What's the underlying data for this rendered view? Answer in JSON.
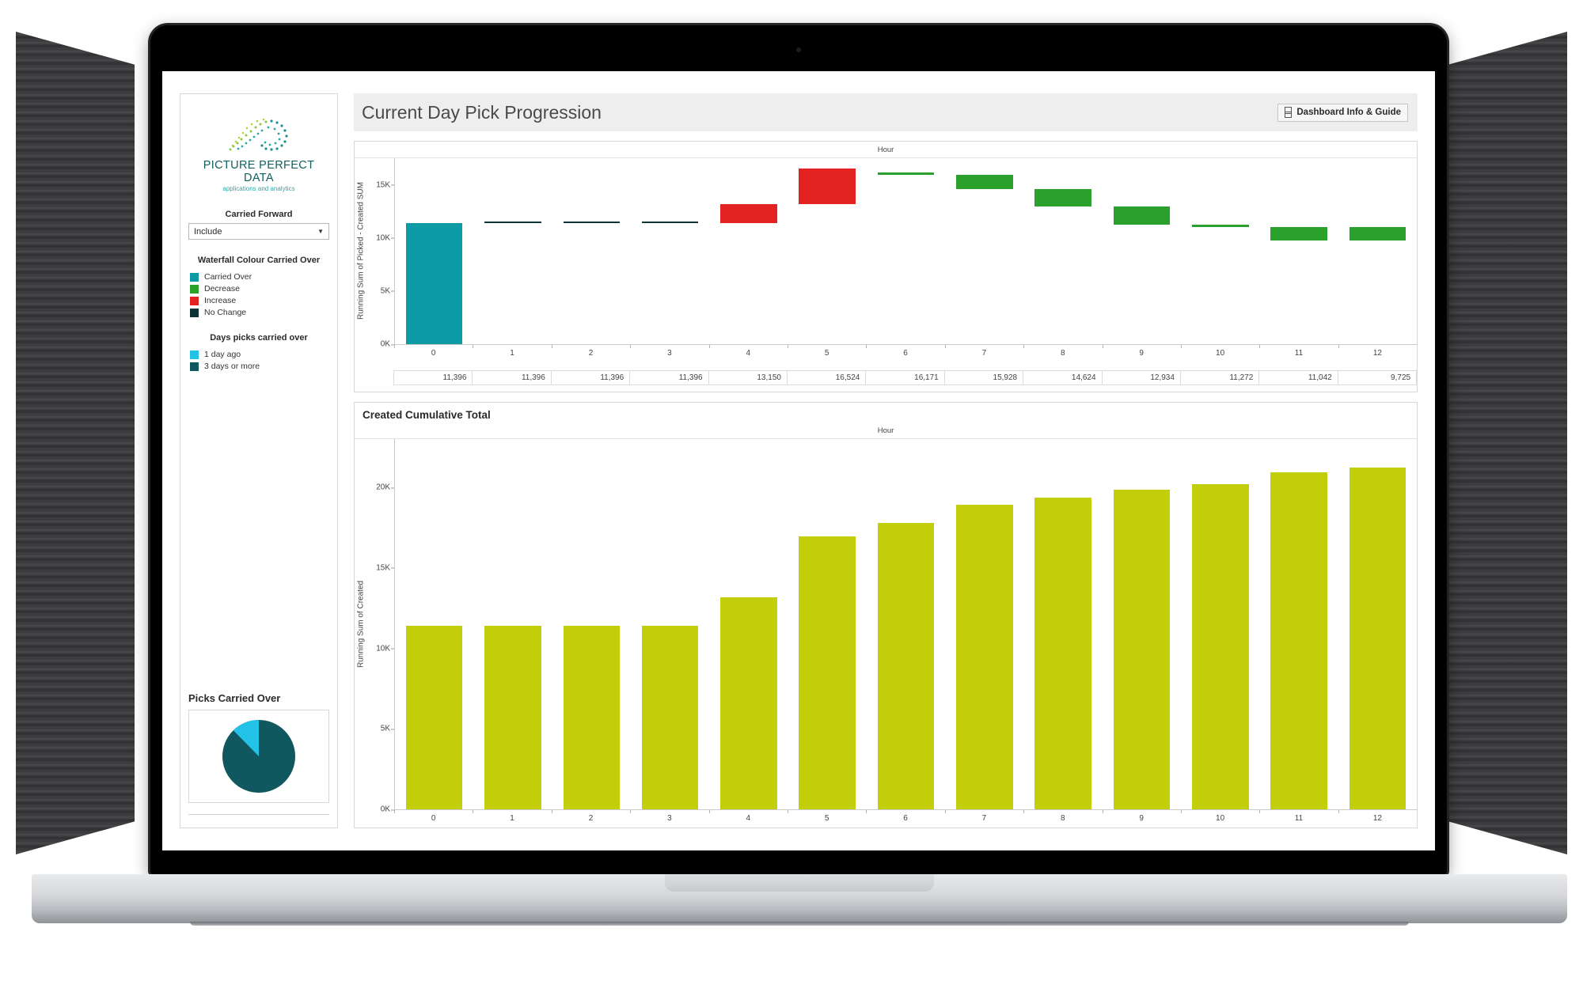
{
  "sidebar": {
    "logo": {
      "name": "PICTURE PERFECT DATA",
      "tagline": "applications and analytics",
      "mark": "dotted-swirl-icon"
    },
    "carried_forward": {
      "label": "Carried Forward",
      "value": "Include",
      "caret": "chevron-down-icon"
    },
    "waterfall_legend": {
      "title": "Waterfall Colour Carried Over",
      "items": [
        {
          "label": "Carried Over",
          "color": "#0c9aa4"
        },
        {
          "label": "Decrease",
          "color": "#2ba02b"
        },
        {
          "label": "Increase",
          "color": "#e32222"
        },
        {
          "label": "No Change",
          "color": "#0f3438"
        }
      ]
    },
    "days_legend": {
      "title": "Days picks carried over",
      "items": [
        {
          "label": "1 day ago",
          "color": "#22c3e6"
        },
        {
          "label": "3 days or more",
          "color": "#10575f"
        }
      ]
    },
    "picks_carried_over": {
      "title": "Picks Carried Over",
      "slices": [
        {
          "label": "1 day ago",
          "value": 12,
          "color": "#22c3e6"
        },
        {
          "label": "3 days or more",
          "value": 88,
          "color": "#10575f"
        }
      ]
    }
  },
  "header": {
    "title": "Current Day Pick Progression",
    "info_button": {
      "label": "Dashboard Info & Guide",
      "icon": "book-icon"
    }
  },
  "chart_data": [
    {
      "type": "bar",
      "name": "waterfall",
      "title": "",
      "xlabel": "Hour",
      "ylabel": "Running Sum of Picked - Created SUM",
      "categories": [
        "0",
        "1",
        "2",
        "3",
        "4",
        "5",
        "6",
        "7",
        "8",
        "9",
        "10",
        "11",
        "12"
      ],
      "values": [
        11396,
        11396,
        11396,
        11396,
        13150,
        16524,
        16171,
        15928,
        14624,
        12934,
        11272,
        11042,
        9725
      ],
      "value_labels": [
        "11,396",
        "11,396",
        "11,396",
        "11,396",
        "13,150",
        "16,524",
        "16,171",
        "15,928",
        "14,624",
        "12,934",
        "11,272",
        "11,042",
        "9,725"
      ],
      "bar_bases": [
        0,
        11396,
        11396,
        11396,
        11396,
        13150,
        15928,
        14624,
        12934,
        11272,
        11042,
        9725,
        9725
      ],
      "bar_tops": [
        11396,
        11396,
        11396,
        11396,
        13150,
        16524,
        16171,
        15928,
        14624,
        12934,
        11272,
        11042,
        11042
      ],
      "bar_colors": [
        "#0c9aa4",
        "#0f3438",
        "#0f3438",
        "#0f3438",
        "#e32222",
        "#e32222",
        "#2ba02b",
        "#2ba02b",
        "#2ba02b",
        "#2ba02b",
        "#2ba02b",
        "#2ba02b",
        "#2ba02b"
      ],
      "ylim": [
        0,
        17500
      ],
      "yticks": [
        0,
        5000,
        10000,
        15000
      ],
      "ytick_labels": [
        "0K",
        "5K",
        "10K",
        "15K"
      ],
      "grid": false,
      "legend_position": "sidebar"
    },
    {
      "type": "bar",
      "name": "created-cumulative-total",
      "title": "Created Cumulative Total",
      "xlabel": "Hour",
      "ylabel": "Running Sum of Created",
      "categories": [
        "0",
        "1",
        "2",
        "3",
        "4",
        "5",
        "6",
        "7",
        "8",
        "9",
        "10",
        "11",
        "12"
      ],
      "values": [
        11396,
        11396,
        11396,
        11396,
        13150,
        16963,
        17800,
        18900,
        19350,
        19850,
        20200,
        20950,
        21250
      ],
      "color": "#c3ce0b",
      "ylim": [
        0,
        23000
      ],
      "yticks": [
        0,
        5000,
        10000,
        15000,
        20000
      ],
      "ytick_labels": [
        "0K",
        "5K",
        "10K",
        "15K",
        "20K"
      ],
      "grid": false,
      "legend_position": "none"
    }
  ]
}
